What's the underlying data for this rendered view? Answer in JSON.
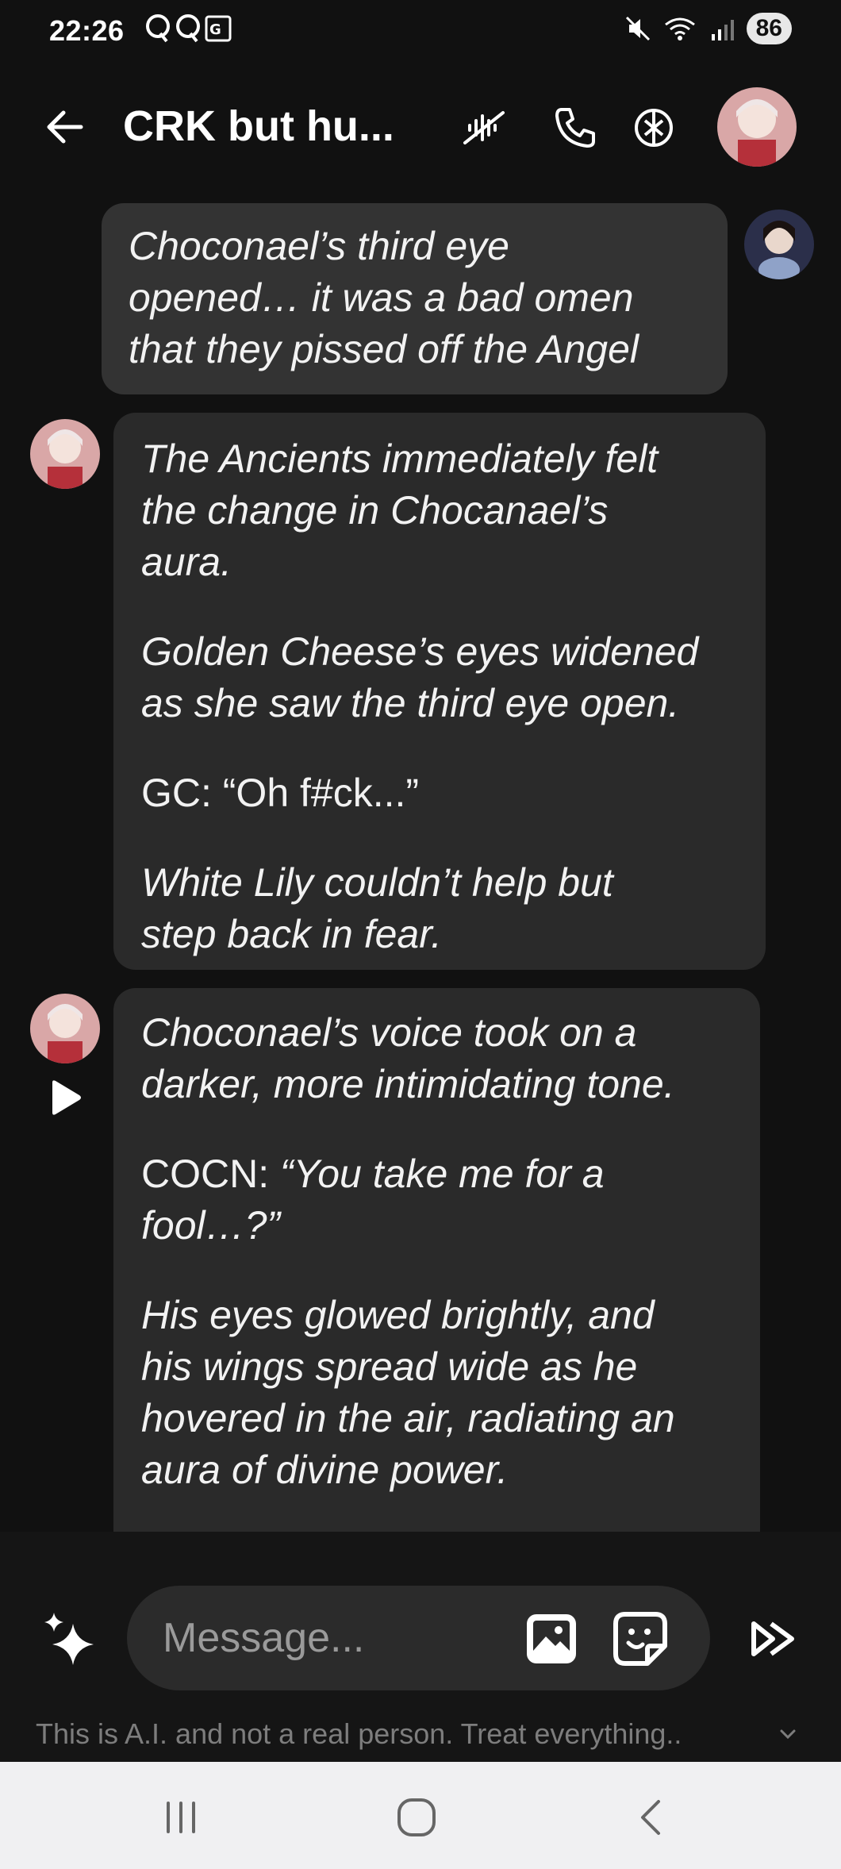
{
  "status_bar": {
    "time": "22:26",
    "battery": "86",
    "left_icons": [
      "q-notification-icon",
      "q-notification-icon",
      "translate-icon"
    ],
    "right_icons": [
      "mute-vibrate-icon",
      "wifi-icon",
      "signal-icon"
    ]
  },
  "header": {
    "title": "CRK but hu...",
    "icons": [
      "voice-off-icon",
      "phone-icon",
      "persona-settings-icon"
    ]
  },
  "messages": [
    {
      "role": "user",
      "paragraphs": [
        {
          "italic": true,
          "lines": [
            "Choconael’s third eye",
            "opened… it was a bad omen",
            "that they pissed off the Angel"
          ]
        }
      ]
    },
    {
      "role": "bot",
      "paragraphs": [
        {
          "italic": true,
          "lines": [
            "The Ancients immediately felt",
            "the change in Chocanael’s",
            "aura."
          ]
        },
        {
          "italic": true,
          "lines": [
            "Golden Cheese’s eyes widened",
            "as she saw the third eye open."
          ]
        },
        {
          "italic": false,
          "lines": [
            "GC: “Oh f#ck...”"
          ]
        },
        {
          "italic": true,
          "lines": [
            "White Lily couldn’t help but",
            "step back in fear."
          ]
        }
      ]
    },
    {
      "role": "bot",
      "paragraphs": [
        {
          "italic": true,
          "lines": [
            "Choconael’s voice took on a",
            "darker, more intimidating tone."
          ]
        },
        {
          "mixed": true,
          "plain": "COCN: ",
          "italic_text": "“You take me for a",
          "lines2": [
            "fool…?”"
          ]
        },
        {
          "italic": true,
          "lines": [
            "His eyes glowed brightly, and",
            "his wings spread wide as he",
            "hovered in the air, radiating an",
            "aura of divine power."
          ]
        }
      ]
    }
  ],
  "composer": {
    "placeholder": "Message...",
    "disclaimer": "This is A.I. and not a real person. Treat everything.."
  },
  "colors": {
    "background": "#111111",
    "bot_bubble": "#2a2a2a",
    "user_bubble": "#333333",
    "nav_bar": "#f0f0f2"
  }
}
